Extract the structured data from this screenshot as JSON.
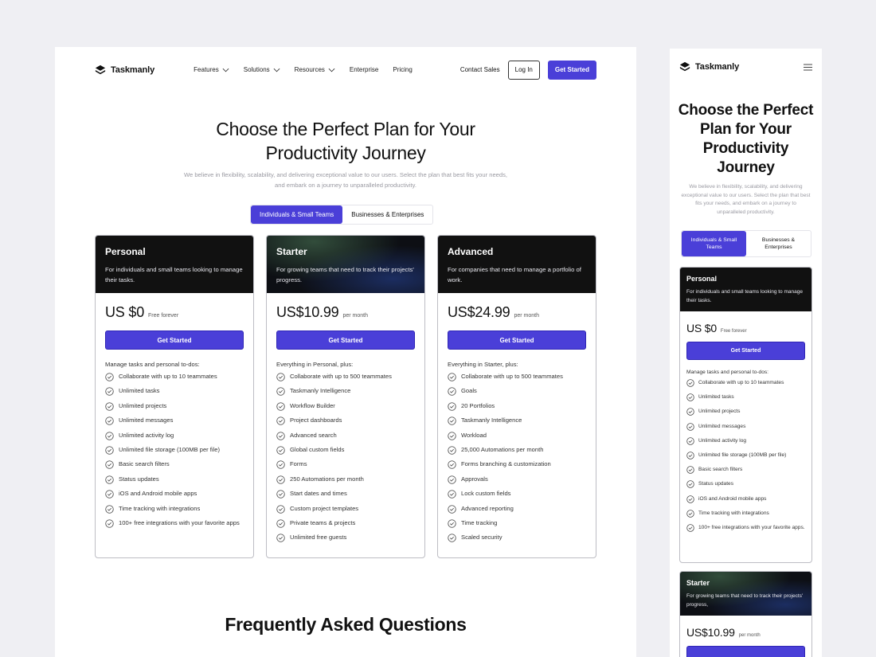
{
  "brand": {
    "name": "Taskmanly",
    "logo_icon": "cube-logo-icon"
  },
  "colors": {
    "accent": "#4a3fd8",
    "header_dark": "#111111",
    "muted_text": "#9a9aa2"
  },
  "nav": {
    "items": [
      {
        "label": "Features",
        "dropdown": true
      },
      {
        "label": "Solutions",
        "dropdown": true
      },
      {
        "label": "Resources",
        "dropdown": true
      },
      {
        "label": "Enterprise",
        "dropdown": false
      },
      {
        "label": "Pricing",
        "dropdown": false
      }
    ],
    "contact_sales": "Contact Sales",
    "log_in": "Log In",
    "get_started": "Get Started"
  },
  "hero": {
    "title_line1": "Choose the Perfect Plan for Your",
    "title_line2": "Productivity Journey",
    "subtitle": "We believe in flexibility, scalability, and delivering exceptional value to our users. Select the plan that best fits your needs, and embark on a journey to unparalleled productivity."
  },
  "toggle": {
    "active": "Individuals & Small Teams",
    "inactive": "Businesses & Enterprises"
  },
  "plans": [
    {
      "name": "Personal",
      "description": "For individuals and small teams looking to manage their tasks.",
      "price": "US $0",
      "period": "Free forever",
      "cta": "Get Started",
      "intro": "Manage tasks and personal to-dos:",
      "features": [
        "Collaborate with up to 10 teammates",
        "Unlimited tasks",
        "Unlimited projects",
        "Unlimited messages",
        "Unlimited activity log",
        "Unlimited file storage (100MB per file)",
        "Basic search filters",
        "Status updates",
        "iOS and Android mobile apps",
        "Time tracking with integrations",
        "100+ free integrations with your favorite apps"
      ]
    },
    {
      "name": "Starter",
      "description": "For growing teams that need to track their projects' progress.",
      "price": "US$10.99",
      "period": "per month",
      "cta": "Get Started",
      "intro": "Everything in Personal, plus:",
      "features": [
        "Collaborate with up to 500 teammates",
        "Taskmanly Intelligence",
        "Workflow Builder",
        "Project dashboards",
        "Advanced search",
        "Global custom fields",
        "Forms",
        "250 Automations per month",
        "Start dates and times",
        "Custom project templates",
        "Private teams & projects",
        "Unlimited free guests"
      ]
    },
    {
      "name": "Advanced",
      "description": "For companies that need to manage a portfolio of work.",
      "price": "US$24.99",
      "period": "per month",
      "cta": "Get Started",
      "intro": "Everything in Starter, plus:",
      "features": [
        "Collaborate with up to 500 teammates",
        "Goals",
        "20 Portfolios",
        "Taskmanly Intelligence",
        "Workload",
        "25,000 Automations per month",
        "Forms branching & customization",
        "Approvals",
        "Lock custom fields",
        "Advanced reporting",
        "Time tracking",
        "Scaled security"
      ]
    }
  ],
  "faq_title": "Frequently Asked Questions",
  "mobile": {
    "menu_icon": "hamburger-menu-icon",
    "title": "Choose the Perfect Plan for Your Productivity Journey",
    "subtitle": "We believe in flexibility, scalability, and delivering exceptional value to our users. Select the plan that best fits your needs, and embark on a journey to unparalleled productivity.",
    "toggle_active": "Individuals & Small Teams",
    "toggle_inactive": "Businesses & Enterprises",
    "personal": {
      "name": "Personal",
      "description": "For individuals and small teams looking to manage their tasks.",
      "price": "US $0",
      "period": "Free forever",
      "cta": "Get Started",
      "intro": "Manage tasks and personal to-dos:",
      "features": [
        "Collaborate with up to 10 teammates",
        "Unlimited tasks",
        "Unlimited projects",
        "Unlimited messages",
        "Unlimited activity log",
        "Unlimited file storage (100MB per file)",
        "Basic search filters",
        "Status updates",
        "iOS and Android mobile apps",
        "Time tracking with integrations",
        "100+ free integrations with your favorite apps."
      ]
    },
    "starter": {
      "name": "Starter",
      "description": "For growing teams that need to track their projects' progress,",
      "price": "US$10.99",
      "period": "per month"
    }
  }
}
